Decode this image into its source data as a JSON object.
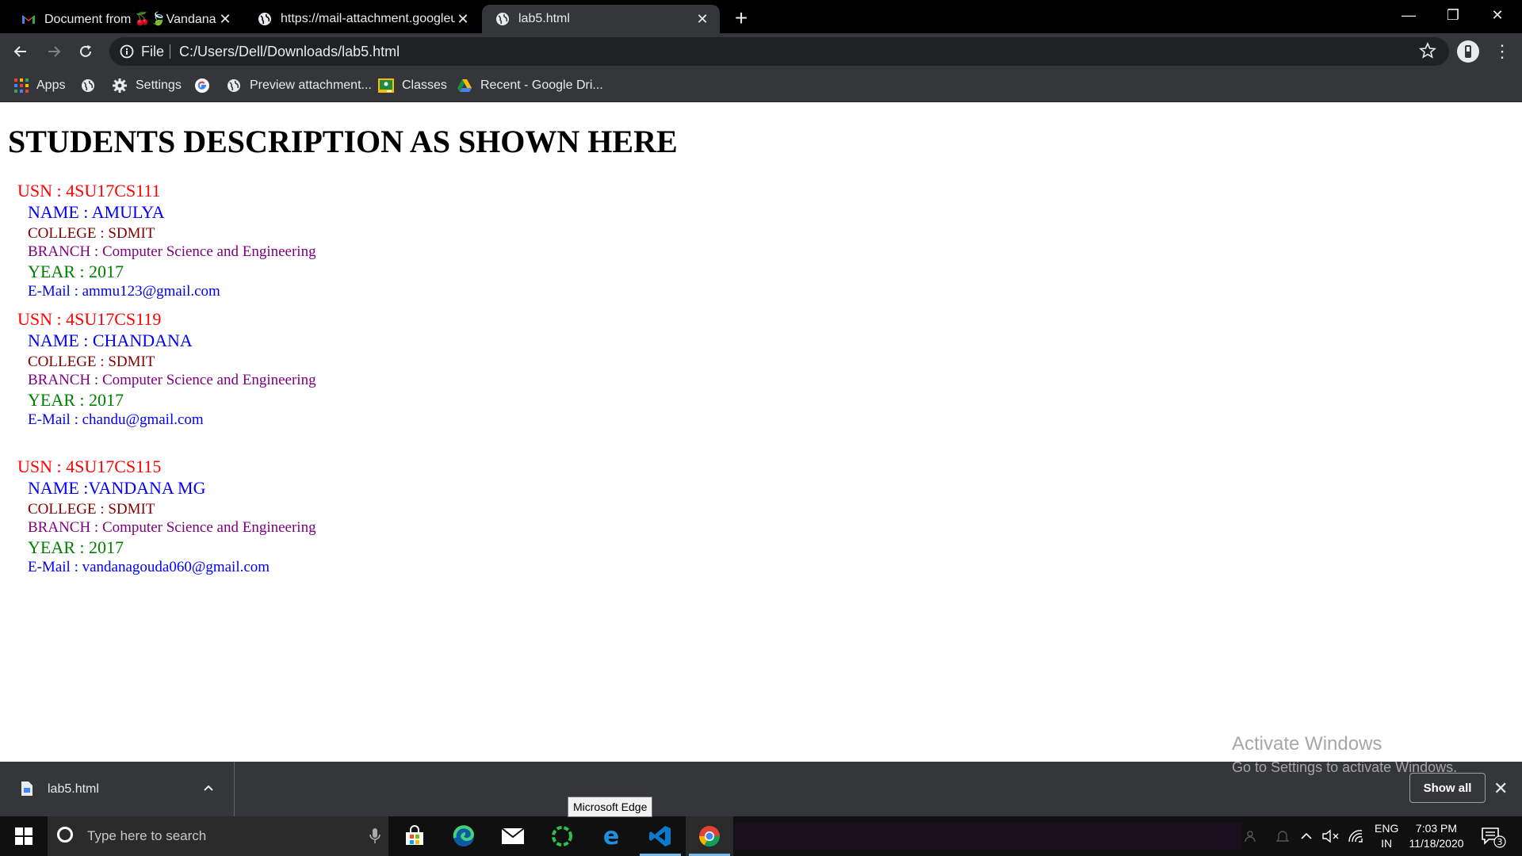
{
  "browser": {
    "tabs": [
      {
        "title": "Document from 🍒🍃Vandana M",
        "favicon": "gmail-icon",
        "active": false
      },
      {
        "title": "https://mail-attachment.googleusercontent.com",
        "favicon": "globe-icon",
        "active": false
      },
      {
        "title": "lab5.html",
        "favicon": "globe-icon",
        "active": true
      }
    ],
    "new_tab_label": "+",
    "address": {
      "scheme": "File",
      "url": "C:/Users/Dell/Downloads/lab5.html"
    },
    "bookmarks": [
      {
        "label": "Apps",
        "icon": "apps-grid-icon"
      },
      {
        "label": "",
        "icon": "globe-icon"
      },
      {
        "label": "Settings",
        "icon": "gear-icon"
      },
      {
        "label": "",
        "icon": "google-icon"
      },
      {
        "label": "Preview attachment...",
        "icon": "globe-icon"
      },
      {
        "label": "Classes",
        "icon": "classroom-icon"
      },
      {
        "label": "Recent - Google Dri...",
        "icon": "google-drive-icon"
      }
    ]
  },
  "page": {
    "heading": "STUDENTS DESCRIPTION AS SHOWN HERE",
    "students": [
      {
        "usn": "USN : 4SU17CS111",
        "name": "NAME : AMULYA",
        "college": "COLLEGE : SDMIT",
        "branch": "BRANCH : Computer Science and Engineering",
        "year": "YEAR : 2017",
        "email": "E-Mail : ammu123@gmail.com"
      },
      {
        "usn": "USN : 4SU17CS119",
        "name": "NAME : CHANDANA",
        "college": "COLLEGE : SDMIT",
        "branch": "BRANCH : Computer Science and Engineering",
        "year": "YEAR : 2017",
        "email": "E-Mail : chandu@gmail.com"
      },
      {
        "usn": "USN : 4SU17CS115",
        "name": "NAME :VANDANA MG",
        "college": "COLLEGE : SDMIT",
        "branch": "BRANCH : Computer Science and Engineering",
        "year": "YEAR : 2017",
        "email": "E-Mail : vandanagouda060@gmail.com"
      }
    ]
  },
  "watermark": {
    "line1": "Activate Windows",
    "line2": "Go to Settings to activate Windows."
  },
  "download_bar": {
    "file": "lab5.html",
    "show_all": "Show all"
  },
  "tooltip": "Microsoft Edge",
  "taskbar": {
    "search_placeholder": "Type here to search",
    "apps": [
      "microsoft-store-icon",
      "edge-chromium-icon",
      "mail-icon",
      "spinner-app-icon",
      "edge-legacy-icon",
      "vscode-icon",
      "chrome-icon"
    ],
    "language": {
      "lang": "ENG",
      "region": "IN"
    },
    "time": "7:03 PM",
    "date": "11/18/2020",
    "notification_count": "3"
  },
  "colors": {
    "usn": "#ff0000",
    "name": "#0000ff",
    "college": "#800000",
    "branch": "#800080",
    "year": "#008000",
    "email": "#0000ff"
  }
}
